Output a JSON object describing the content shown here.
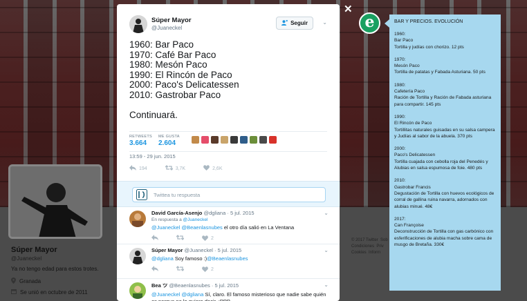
{
  "profile": {
    "name": "Súper Mayor",
    "handle": "@Juaneckel",
    "bio": "Ya no tengo edad para estos trotes.",
    "location": "Granada",
    "joined": "Se unió en octubre de 2011"
  },
  "footer": [
    "© 2017 Twitter",
    "Sob",
    "Condiciones",
    "Priv",
    "Cookies",
    "Inform"
  ],
  "tweet": {
    "author_name": "Súper Mayor",
    "author_handle": "@Juaneckel",
    "follow_label": "Seguir",
    "lines": [
      "1960: Bar Paco",
      "1970: Café Bar Paco",
      "1980: Mesón Paco",
      "1990: El Rincón de Paco",
      "2000: Paco's Delicatessen",
      "2010: Gastrobar Paco",
      "Continuará."
    ],
    "retweets_label": "RETWEETS",
    "retweets": "3.664",
    "likes_label": "ME GUSTA",
    "likes": "2.604",
    "time": "13:59 - 29 jun. 2015",
    "reply_count": "194",
    "retweet_count": "3,7K",
    "like_count": "2,6K",
    "reply_placeholder": "Twittea tu respuesta"
  },
  "replies": [
    {
      "name": "David García-Asenjo",
      "handle": "@dgliana",
      "date": "5 jul. 2015",
      "context_prefix": "En respuesta a",
      "context_handle": "@Juaneckel",
      "mentions": "@Juaneckel @Beaenlasnubes",
      "text": " el otro día salió en La Ventana",
      "retweets": "",
      "likes": "2"
    },
    {
      "name": "Súper Mayor",
      "handle": "@Juaneckel",
      "date": "5 jul. 2015",
      "mentions": "@dgliana",
      "text_mid": " Soy famoso :)",
      "mention2": "@Beaenlasnubes",
      "likes": "2"
    },
    {
      "name": "Bea ツ",
      "handle": "@Beaenlasnubes",
      "date": "5 jul. 2015",
      "mentions": "@Juaneckel @dgliana",
      "text": " Sí, claro. El famoso misterioso que nadie sabe quién es porque no lo quiere decir. ;PPP"
    }
  ],
  "panel": {
    "title": "BAR Y PRECIOS. EVOLUCIÓN",
    "entries": [
      {
        "year": "1960:",
        "name": "Bar Paco",
        "desc": "Tortilla y judías con chorizo. 12 pts"
      },
      {
        "year": "1970:",
        "name": "Mesón Paco",
        "desc": "Tortilla de patatas y Fabada Asturiana. 50 pts"
      },
      {
        "year": "1980:",
        "name": "Cafetería Paco",
        "desc": "Ración de Tortilla y Ración de Fabada asturiana para compartir. 145 pts"
      },
      {
        "year": "1990:",
        "name": "El Rincón de Paco",
        "desc": "Tortillitas naturales guisadas en su salsa campera y Judías al sabor de la abuela. 370 pts"
      },
      {
        "year": "2000:",
        "name": "Paco's Delicatessen",
        "desc": "Tortilla cuajada con cebolla roja del Penedés y Alubias en salsa espumosa de foie. 480 pts"
      },
      {
        "year": "2010:",
        "name": "Gastrobar Francis",
        "desc": "Degustación de Tortilla con huevos ecológicos de corral de gallina ruina navarra, adornados con alubias minué. 48€"
      },
      {
        "year": "2017:",
        "name": "Can Françoise",
        "desc": "Deconstrucción de Tortilla con gas carbónico con esferificaciones de alubia macha sobre cama de musgo de Bretaña. 330€"
      }
    ]
  },
  "colors": {
    "accent": "#1b95e0",
    "panel": "#a7d8ef",
    "logo": "#1aa061"
  }
}
